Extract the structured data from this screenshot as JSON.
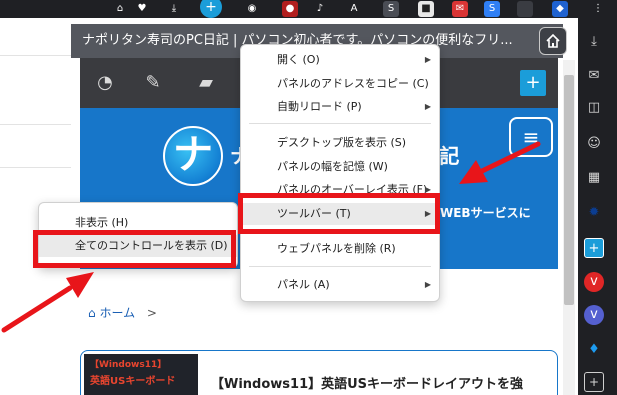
{
  "panel": {
    "title": "ナポリタン寿司のPC日記 | パソコン初心者です。パソコンの便利なフリ...",
    "home_icon": "home-icon"
  },
  "site": {
    "name": "ナポリタン寿司のPC日記",
    "tagline": "WEBサービスに",
    "breadcrumb_home": "ホーム",
    "breadcrumb_sep": ">",
    "article_title": "【Windows11】英語USキーボードレイアウトを強",
    "thumb_line1": "【Windows11】",
    "thumb_line2": "英語USキーボード"
  },
  "main_menu": {
    "items": [
      {
        "label": "開く (O)",
        "has_submenu": true
      },
      {
        "label": "パネルのアドレスをコピー (C)",
        "has_submenu": false
      },
      {
        "label": "自動リロード (P)",
        "has_submenu": true
      },
      {
        "label": "デスクトップ版を表示 (S)",
        "has_submenu": false
      },
      {
        "label": "パネルの幅を記憶 (W)",
        "has_submenu": false
      },
      {
        "label": "パネルのオーバーレイ表示 (F)",
        "has_submenu": true
      },
      {
        "label": "ツールバー (T)",
        "has_submenu": true
      },
      {
        "label": "ウェブパネルを削除 (R)",
        "has_submenu": false
      },
      {
        "label": "パネル (A)",
        "has_submenu": true
      }
    ]
  },
  "sub_menu": {
    "items": [
      {
        "label": "非表示 (H)"
      },
      {
        "label": "全てのコントロールを表示 (D)"
      }
    ]
  },
  "colors": {
    "highlight_red": "#e8151a",
    "site_blue": "#1776c9",
    "panel_dark": "#54575e"
  }
}
